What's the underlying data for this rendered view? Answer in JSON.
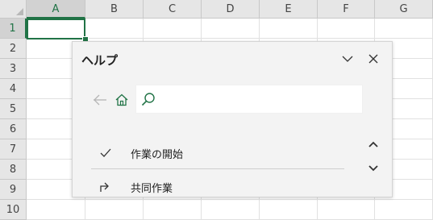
{
  "spreadsheet": {
    "columns": [
      "A",
      "B",
      "C",
      "D",
      "E",
      "F",
      "G"
    ],
    "rows": [
      "1",
      "2",
      "3",
      "4",
      "5",
      "6",
      "7",
      "8",
      "9",
      "10"
    ],
    "selected_column": "A",
    "selected_row": "1",
    "accent_color": "#217346"
  },
  "help_pane": {
    "title": "ヘルプ",
    "collapse_icon": "chevron-down-icon",
    "close_icon": "close-icon",
    "back_icon": "back-arrow-icon",
    "home_icon": "home-icon",
    "search_icon": "search-icon",
    "search_value": "",
    "topics": [
      {
        "label": "作業の開始",
        "icon": "checkmark-icon"
      },
      {
        "label": "共同作業",
        "icon": "share-icon"
      }
    ],
    "scroll_up_icon": "chevron-up-icon",
    "scroll_down_icon": "chevron-down-icon"
  }
}
